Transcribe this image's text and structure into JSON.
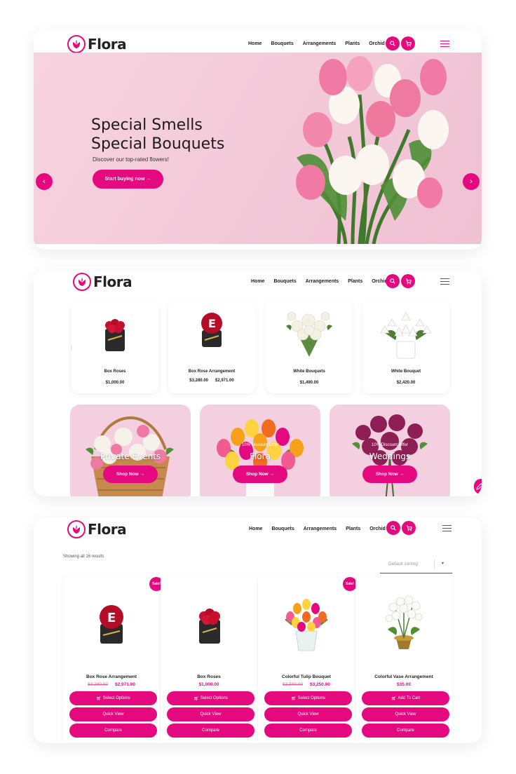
{
  "brand": {
    "name": "Flora",
    "accent": "#e5097f"
  },
  "nav": {
    "items": [
      "Home",
      "Bouquets",
      "Arrangements",
      "Plants",
      "Orchid"
    ],
    "search_icon": "search-icon",
    "cart_icon": "cart-icon",
    "menu_icon": "hamburger-icon"
  },
  "hero": {
    "title_line1": "Special Smells",
    "title_line2": "Special Bouquets",
    "subtitle": "Discover our top-rated flowers!",
    "cta": "Start buying now →",
    "prev": "‹",
    "next": "›"
  },
  "carousel": {
    "prev": "‹",
    "next": "›",
    "products": [
      {
        "name": "Box Roses",
        "price": "$1,000.00"
      },
      {
        "name": "Box Rose Arrangement",
        "old_price": "$3,280.00",
        "price": "$2,971.00"
      },
      {
        "name": "White Bouquets",
        "price": "$1,490.00"
      },
      {
        "name": "White Bouquet",
        "price": "$2,420.00"
      }
    ]
  },
  "promos": [
    {
      "kicker": "",
      "title": "Private Events",
      "cta": "Shop Now →"
    },
    {
      "kicker": "10% Discount Offer",
      "title": "Flora",
      "cta": "Shop Now →"
    },
    {
      "kicker": "10% Discount Offer",
      "title": "Weddings",
      "cta": "Shop Now →"
    }
  ],
  "shop": {
    "results": "Showing all 16 results",
    "sorting": "Default sorting",
    "sale_label": "Sale!",
    "products": [
      {
        "name": "Box Rose Arrangement",
        "old_price": "$3,280.00",
        "price": "$2,971.00",
        "primary": "Select Options",
        "sale": true
      },
      {
        "name": "Box Roses",
        "old_price": "",
        "price": "$1,000.00",
        "primary": "Select Options",
        "sale": false
      },
      {
        "name": "Colorful Tulip Bouquet",
        "old_price": "$3,500.00",
        "price": "$3,250.00",
        "primary": "Select Options",
        "sale": true
      },
      {
        "name": "Colorful Vase Arrangement",
        "old_price": "",
        "price": "$35.00",
        "primary": "Add To Cart",
        "sale": false
      }
    ],
    "quick_view": "Quick View",
    "compare": "Compare"
  }
}
